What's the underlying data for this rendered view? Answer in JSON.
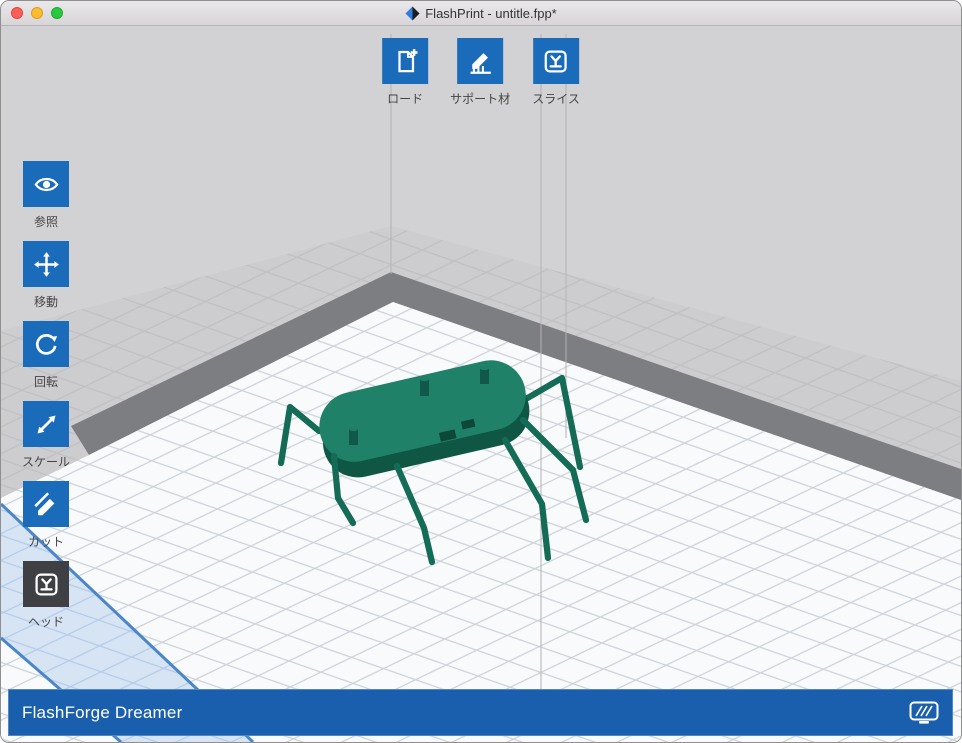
{
  "window": {
    "title": "FlashPrint - untitle.fpp*"
  },
  "toolbar": {
    "items": [
      {
        "id": "load",
        "label": "ロード",
        "icon": "load-icon"
      },
      {
        "id": "support",
        "label": "サポート材",
        "icon": "support-material-icon"
      },
      {
        "id": "slice",
        "label": "スライス",
        "icon": "slice-icon"
      }
    ]
  },
  "sidebar": {
    "items": [
      {
        "id": "view",
        "label": "参照",
        "icon": "eye-icon"
      },
      {
        "id": "move",
        "label": "移動",
        "icon": "move-icon"
      },
      {
        "id": "rotate",
        "label": "回転",
        "icon": "rotate-icon"
      },
      {
        "id": "scale",
        "label": "スケール",
        "icon": "scale-icon"
      },
      {
        "id": "cut",
        "label": "カット",
        "icon": "cut-icon"
      },
      {
        "id": "head",
        "label": "ヘッド",
        "icon": "head-icon"
      }
    ]
  },
  "statusbar": {
    "printer_name": "FlashForge Dreamer"
  },
  "colors": {
    "accent_blue": "#1a6cba",
    "statusbar_blue": "#1a5fae",
    "head_button_dark": "#3f4043",
    "model_green_top": "#1e8168",
    "model_green_side": "#105645",
    "plate_band_gray": "#7d7e81",
    "blue_zone_fill": "#d7e4f4",
    "blue_zone_edge": "#4a86c8"
  }
}
